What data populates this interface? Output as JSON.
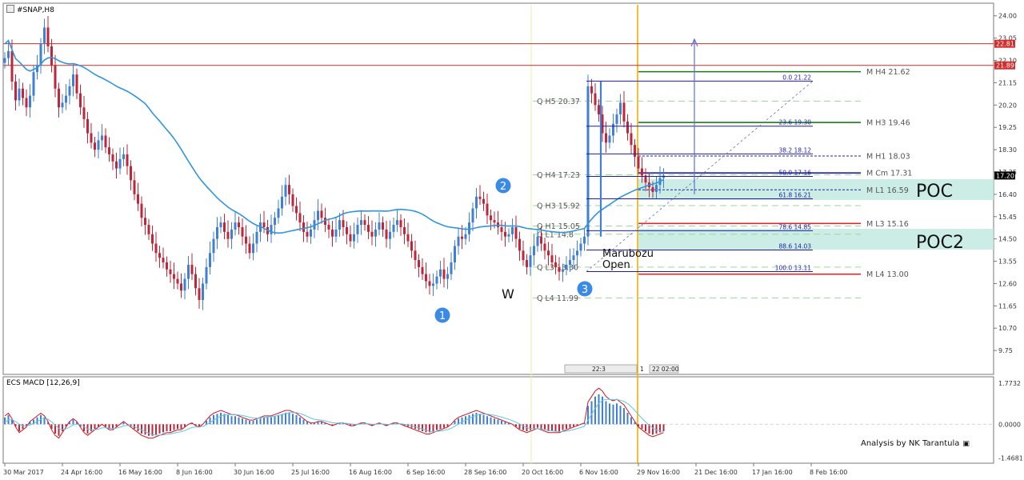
{
  "window": {
    "title": "#SNAP,H8"
  },
  "colors": {
    "bull": "#3f7fd6",
    "bear": "#c0263a",
    "ma": "#2f95df",
    "res": "#d22c2c",
    "fib": "#1f1fa6",
    "green": "#1b7a1b",
    "poc": "#bfe8df",
    "vline": "#f0b000",
    "dash": "#9bd89b",
    "macd": "#d01820",
    "signal": "#5cc6e4"
  },
  "price_axis": {
    "min": 8.8,
    "max": 24.4,
    "ticks": [
      "24.00",
      "23.05",
      "22.10",
      "21.15",
      "20.20",
      "19.25",
      "18.30",
      "17.35",
      "16.40",
      "15.45",
      "14.50",
      "13.55",
      "12.60",
      "11.65",
      "10.70",
      "9.75"
    ],
    "tick_values": [
      24.0,
      23.05,
      22.1,
      21.15,
      20.2,
      19.25,
      18.3,
      17.35,
      16.4,
      15.45,
      14.5,
      13.55,
      12.6,
      11.65,
      10.7,
      9.75
    ],
    "badges": [
      {
        "label": "22.81",
        "value": 22.81,
        "color": "#d22c2c"
      },
      {
        "label": "21.89",
        "value": 21.89,
        "color": "#d22c2c"
      },
      {
        "label": "17.20",
        "value": 17.2,
        "color": "#000000"
      }
    ]
  },
  "time_axis": {
    "labels": [
      "30 Mar 2017",
      "24 Apr 16:00",
      "16 May 16:00",
      "8 Jun 16:00",
      "30 Jun 16:00",
      "25 Jul 16:00",
      "16 Aug 16:00",
      "6 Sep 16:00",
      "28 Sep 16:00",
      "20 Oct 16:00",
      "6 Nov 16:00",
      "29 Nov 16:00",
      "21 Dec 16:00",
      "17 Jan 16:00",
      "8 Feb 16:00"
    ],
    "label_index": [
      0,
      16,
      32,
      48,
      64,
      80,
      96,
      112,
      128,
      144,
      160,
      176,
      192,
      208,
      224
    ]
  },
  "chart_data": {
    "type": "candlestick",
    "timeframe": "H8",
    "series_close": [
      22.2,
      22.5,
      21.2,
      20.4,
      20.9,
      20.5,
      20.1,
      20.6,
      21.6,
      21.9,
      22.8,
      23.5,
      22.7,
      21.9,
      20.9,
      20.1,
      20.3,
      20.6,
      21.0,
      21.5,
      20.7,
      20.1,
      19.6,
      19.0,
      18.6,
      18.3,
      18.7,
      18.9,
      18.4,
      18.1,
      17.8,
      17.5,
      17.9,
      18.1,
      17.6,
      17.0,
      16.4,
      16.0,
      15.4,
      15.1,
      14.7,
      14.3,
      13.9,
      13.7,
      13.5,
      13.2,
      13.0,
      12.8,
      12.6,
      12.3,
      12.8,
      13.4,
      13.0,
      12.4,
      11.9,
      12.6,
      13.3,
      13.9,
      14.5,
      15.0,
      15.2,
      14.8,
      14.5,
      14.9,
      15.2,
      15.0,
      14.6,
      14.3,
      13.9,
      14.3,
      14.8,
      15.2,
      15.0,
      14.7,
      15.1,
      15.4,
      15.8,
      16.3,
      16.8,
      16.4,
      15.9,
      15.6,
      15.2,
      14.8,
      14.6,
      14.9,
      15.3,
      15.7,
      15.4,
      15.1,
      14.9,
      14.6,
      14.9,
      15.3,
      15.0,
      14.7,
      14.4,
      14.7,
      15.1,
      15.3,
      15.1,
      14.8,
      14.6,
      14.9,
      15.2,
      14.9,
      14.5,
      14.8,
      15.1,
      15.3,
      15.0,
      14.7,
      14.4,
      14.0,
      13.6,
      13.3,
      13.0,
      12.7,
      12.5,
      12.6,
      12.9,
      13.2,
      12.8,
      13.0,
      13.5,
      14.2,
      14.6,
      14.5,
      14.7,
      15.2,
      15.8,
      16.3,
      16.2,
      16.0,
      15.5,
      15.3,
      15.2,
      15.0,
      14.8,
      14.6,
      14.7,
      15.0,
      14.5,
      14.0,
      13.6,
      13.3,
      13.8,
      14.2,
      14.6,
      14.3,
      14.0,
      13.8,
      13.5,
      13.3,
      13.1,
      13.2,
      13.4,
      13.6,
      13.8,
      14.0,
      14.3,
      14.6,
      21.0,
      20.7,
      20.2,
      19.8,
      19.0,
      18.6,
      18.9,
      19.4,
      19.8,
      20.3,
      19.5,
      19.0,
      18.5,
      18.0,
      17.5,
      17.2,
      16.9,
      16.7,
      16.5,
      16.8,
      17.1,
      17.2
    ],
    "ma_line": "blue moving average (approx 100)",
    "annotations": {
      "wave_points": [
        "1",
        "2",
        "3"
      ],
      "pattern": "W",
      "candle_note": [
        "Marubozu",
        "Open"
      ],
      "zones": [
        "POC",
        "POC2"
      ],
      "credit": "Analysis by NK Tarantula"
    },
    "horizontal_levels": [
      {
        "value": 22.81,
        "color": "red"
      },
      {
        "value": 21.89,
        "color": "red"
      }
    ],
    "q_levels": [
      {
        "label": "Q  H5 20.37",
        "value": 20.37
      },
      {
        "label": "Q  H4 17.23",
        "value": 17.23
      },
      {
        "label": "Q  H3 15.92",
        "value": 15.92
      },
      {
        "label": "Q  H1 15.05",
        "value": 15.05
      },
      {
        "label": "Q  L1 14.8",
        "value": 14.7
      },
      {
        "label": "Q  L3 13.30",
        "value": 13.3
      },
      {
        "label": "Q  L4 11.99",
        "value": 11.99
      }
    ],
    "m_levels": [
      {
        "label": "M  H4 21.62",
        "value": 21.62
      },
      {
        "label": "M  H3 19.46",
        "value": 19.46
      },
      {
        "label": "M  H1 18.03",
        "value": 18.03
      },
      {
        "label": "M  Cm 17.31",
        "value": 17.31
      },
      {
        "label": "M  L1 16.59",
        "value": 16.59
      },
      {
        "label": "M  L3 15.16",
        "value": 15.16
      },
      {
        "label": "M  L4 13.00",
        "value": 13.0
      }
    ],
    "fib_levels": [
      {
        "label": "0.0   21.22",
        "value": 21.22
      },
      {
        "label": "23.6   19.30",
        "value": 19.3
      },
      {
        "label": "38.2   18.12",
        "value": 18.12
      },
      {
        "label": "50.0   17.16",
        "value": 17.16
      },
      {
        "label": "61.8   16.21",
        "value": 16.21
      },
      {
        "label": "78.6   14.85",
        "value": 14.85
      },
      {
        "label": "88.6   14.03",
        "value": 14.03
      },
      {
        "label": "100.0   13.11",
        "value": 13.11
      }
    ],
    "nav_labels": [
      "22:3",
      "1",
      "22 02:00"
    ]
  },
  "macd": {
    "title": "ECS MACD [12,26,9]",
    "ticks": [
      "1.7732",
      "0.0000",
      "-1.4681"
    ],
    "tick_values": [
      1.7732,
      0.0,
      -1.4681
    ],
    "min": -1.65,
    "max": 1.95,
    "hist": [
      0.3,
      0.4,
      0.2,
      -0.1,
      -0.3,
      -0.2,
      -0.1,
      0.1,
      0.2,
      0.3,
      0.4,
      0.3,
      0.1,
      -0.2,
      -0.4,
      -0.5,
      -0.3,
      -0.1,
      0.1,
      0.2,
      0.1,
      -0.1,
      -0.3,
      -0.4,
      -0.3,
      -0.2,
      -0.1,
      0.0,
      -0.1,
      -0.2,
      -0.2,
      -0.1,
      0.0,
      0.1,
      0.0,
      -0.1,
      -0.2,
      -0.3,
      -0.4,
      -0.45,
      -0.5,
      -0.5,
      -0.45,
      -0.4,
      -0.35,
      -0.3,
      -0.3,
      -0.25,
      -0.2,
      -0.2,
      -0.1,
      0.0,
      0.05,
      -0.05,
      -0.1,
      0.0,
      0.15,
      0.3,
      0.4,
      0.45,
      0.5,
      0.45,
      0.4,
      0.35,
      0.35,
      0.3,
      0.25,
      0.2,
      0.15,
      0.15,
      0.2,
      0.25,
      0.3,
      0.3,
      0.3,
      0.35,
      0.4,
      0.45,
      0.5,
      0.5,
      0.45,
      0.4,
      0.3,
      0.2,
      0.1,
      0.05,
      0.05,
      0.1,
      0.1,
      0.05,
      0.0,
      -0.05,
      0.0,
      0.05,
      0.05,
      0.0,
      -0.05,
      -0.05,
      0.0,
      0.05,
      0.05,
      0.0,
      -0.05,
      0.0,
      0.05,
      0.0,
      -0.05,
      0.0,
      0.05,
      0.05,
      0.0,
      -0.05,
      -0.1,
      -0.15,
      -0.2,
      -0.25,
      -0.3,
      -0.35,
      -0.35,
      -0.3,
      -0.25,
      -0.2,
      -0.15,
      -0.1,
      0.0,
      0.15,
      0.25,
      0.3,
      0.35,
      0.4,
      0.45,
      0.5,
      0.45,
      0.4,
      0.35,
      0.3,
      0.25,
      0.2,
      0.15,
      0.1,
      0.05,
      0.0,
      -0.1,
      -0.2,
      -0.25,
      -0.3,
      -0.25,
      -0.2,
      -0.15,
      -0.2,
      -0.25,
      -0.3,
      -0.3,
      -0.3,
      -0.3,
      -0.25,
      -0.2,
      -0.15,
      -0.1,
      -0.05,
      0.0,
      0.05,
      0.8,
      1.0,
      1.2,
      1.3,
      1.2,
      1.0,
      0.9,
      0.85,
      0.9,
      0.8,
      0.7,
      0.5,
      0.3,
      0.1,
      -0.1,
      -0.2,
      -0.3,
      -0.4,
      -0.45,
      -0.4,
      -0.35,
      -0.3
    ]
  }
}
